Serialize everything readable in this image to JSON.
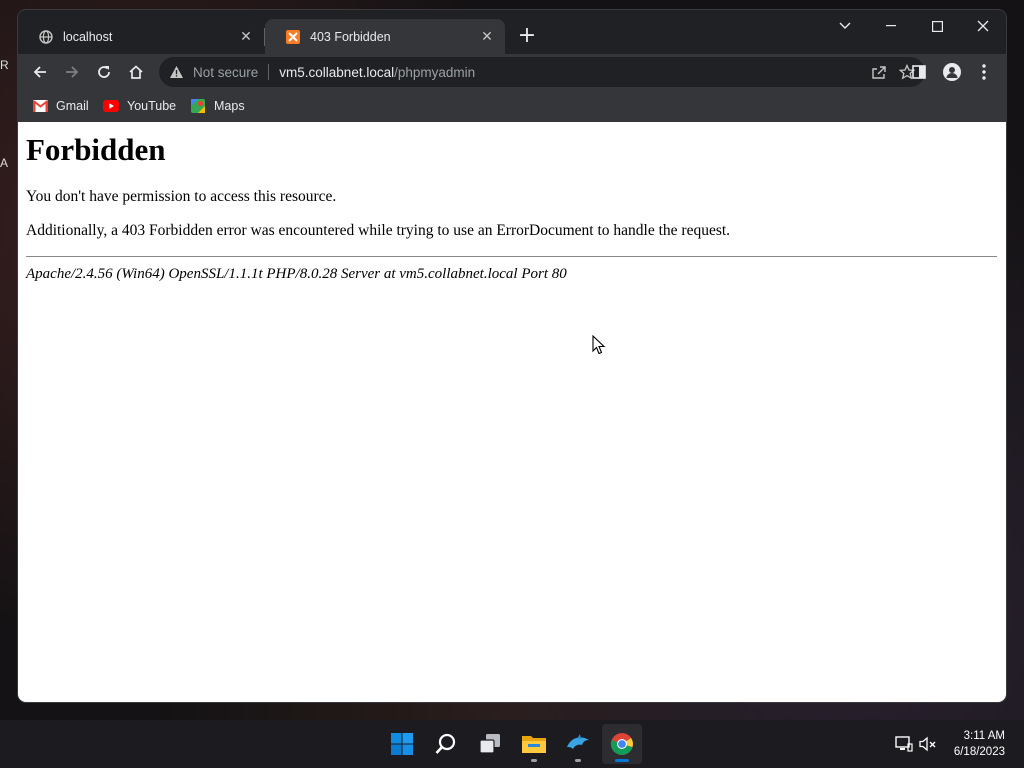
{
  "desktop": {
    "edge_text_1": "R",
    "edge_text_2": "A"
  },
  "browser": {
    "tabs": [
      {
        "title": "localhost",
        "icon": "globe-icon",
        "active": false
      },
      {
        "title": "403 Forbidden",
        "icon": "xampp-icon",
        "active": true
      }
    ],
    "address_bar": {
      "security_label": "Not secure",
      "host": "vm5.collabnet.local",
      "path": "/phpmyadmin"
    },
    "bookmarks": [
      {
        "label": "Gmail",
        "icon": "gmail-icon"
      },
      {
        "label": "YouTube",
        "icon": "youtube-icon"
      },
      {
        "label": "Maps",
        "icon": "maps-icon"
      }
    ]
  },
  "page": {
    "heading": "Forbidden",
    "message": "You don't have permission to access this resource.",
    "detail": "Additionally, a 403 Forbidden error was encountered while trying to use an ErrorDocument to handle the request.",
    "server_signature": "Apache/2.4.56 (Win64) OpenSSL/1.1.1t PHP/8.0.28 Server at vm5.collabnet.local Port 80"
  },
  "taskbar": {
    "apps": [
      "start-icon",
      "search-icon",
      "task-view-icon",
      "file-explorer-icon",
      "dolphin-icon",
      "chrome-icon"
    ],
    "clock": {
      "time": "3:11 AM",
      "date": "6/18/2023"
    }
  },
  "colors": {
    "accent": "#0078d4",
    "tab_active": "#35363a",
    "chrome_dark": "#202124",
    "xampp_orange": "#fb7a24"
  }
}
